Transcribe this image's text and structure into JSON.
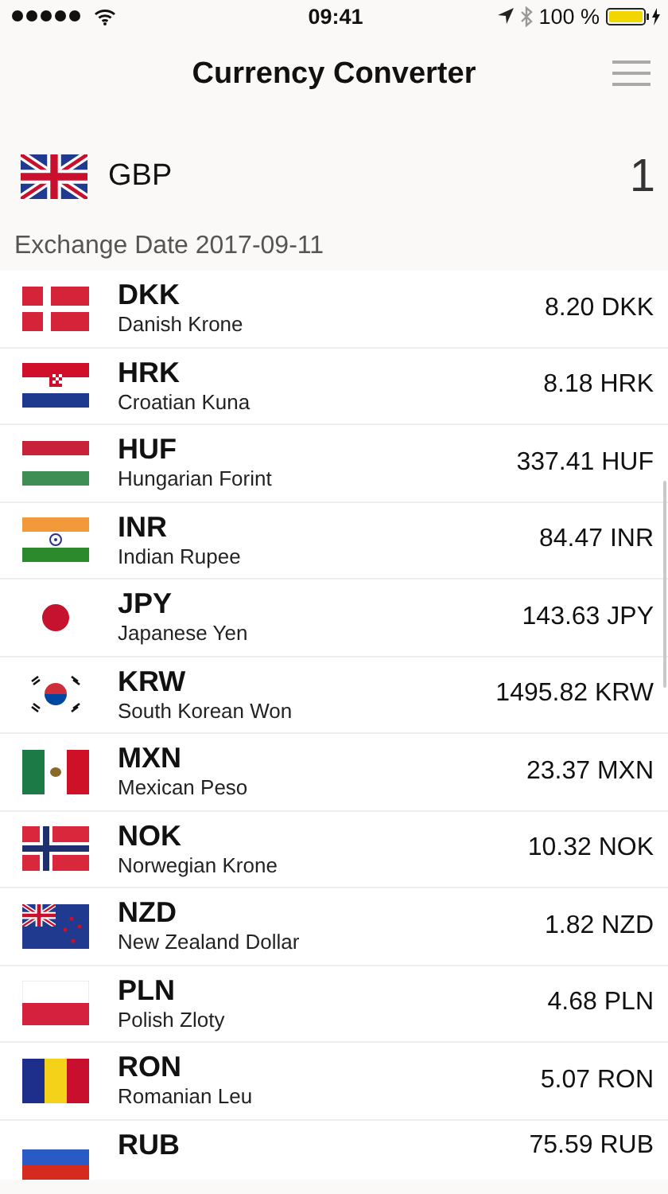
{
  "status_bar": {
    "time": "09:41",
    "battery": "100 %"
  },
  "nav": {
    "title": "Currency Converter"
  },
  "base": {
    "kind": "gb",
    "code": "GBP",
    "amount": "1"
  },
  "exchange_date": "Exchange Date 2017-09-11",
  "rates": [
    {
      "kind": "dk",
      "code": "DKK",
      "name": "Danish Krone",
      "amount": "8.20 DKK"
    },
    {
      "kind": "hr",
      "code": "HRK",
      "name": "Croatian Kuna",
      "amount": "8.18 HRK"
    },
    {
      "kind": "hu",
      "code": "HUF",
      "name": "Hungarian Forint",
      "amount": "337.41 HUF"
    },
    {
      "kind": "in",
      "code": "INR",
      "name": "Indian Rupee",
      "amount": "84.47 INR"
    },
    {
      "kind": "jp",
      "code": "JPY",
      "name": "Japanese Yen",
      "amount": "143.63 JPY"
    },
    {
      "kind": "kr",
      "code": "KRW",
      "name": "South Korean Won",
      "amount": "1495.82 KRW"
    },
    {
      "kind": "mx",
      "code": "MXN",
      "name": "Mexican Peso",
      "amount": "23.37 MXN"
    },
    {
      "kind": "no",
      "code": "NOK",
      "name": "Norwegian Krone",
      "amount": "10.32 NOK"
    },
    {
      "kind": "nz",
      "code": "NZD",
      "name": "New Zealand Dollar",
      "amount": "1.82 NZD"
    },
    {
      "kind": "pl",
      "code": "PLN",
      "name": "Polish Zloty",
      "amount": "4.68 PLN"
    },
    {
      "kind": "ro",
      "code": "RON",
      "name": "Romanian Leu",
      "amount": "5.07 RON"
    },
    {
      "kind": "ru",
      "code": "RUB",
      "amount": "75.59 RUB"
    }
  ]
}
